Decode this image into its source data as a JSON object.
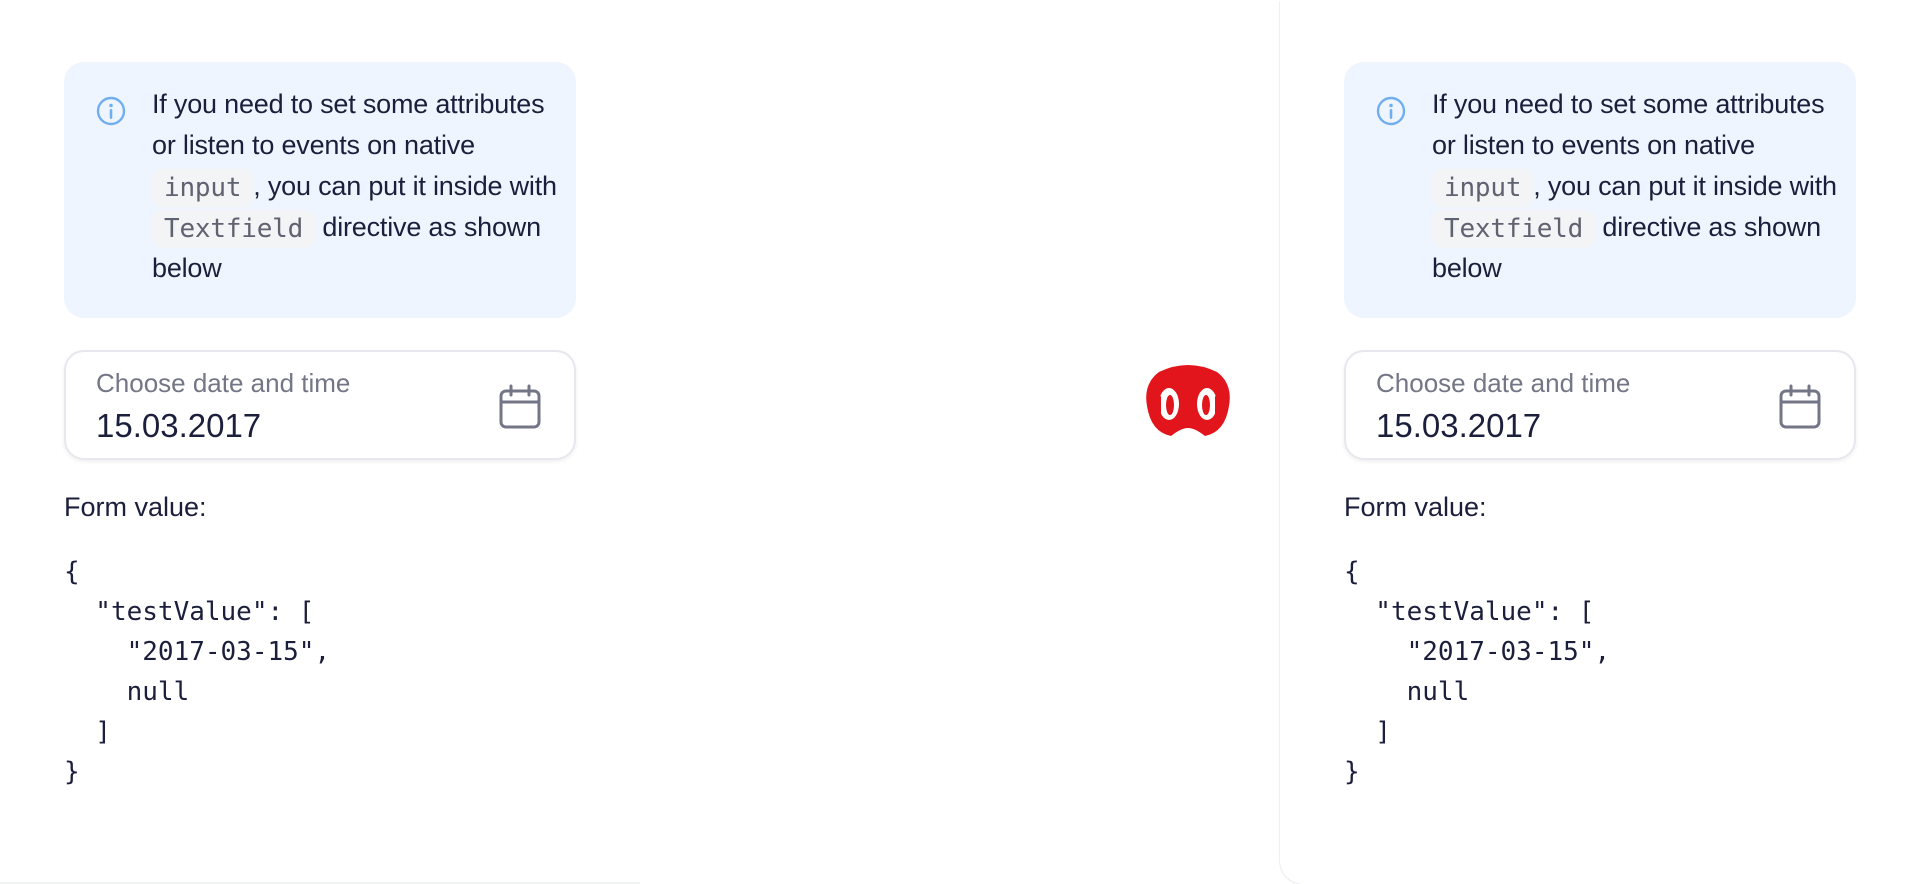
{
  "panels": [
    {
      "notice": {
        "line1": "If you need to set some attributes or listen to events on native ",
        "chip1": "input",
        "line2": ", you can put it inside with ",
        "chip2": "Textfield",
        "line3": " directive as shown below",
        "icon": "info-icon"
      },
      "datefield": {
        "label": "Choose date and time",
        "value": "15.03.2017",
        "icon": "calendar-icon"
      },
      "form_label": "Form value:",
      "form_json": "{\n  \"testValue\": [\n    \"2017-03-15\",\n    null\n  ]\n}"
    },
    {
      "notice": {
        "line1": "If you need to set some attributes or listen to events on native ",
        "chip1": "input",
        "line2": ", you can put it inside with ",
        "chip2": "Textfield",
        "line3": " directive as shown below",
        "icon": "info-icon"
      },
      "datefield": {
        "label": "Choose date and time",
        "value": "15.03.2017",
        "icon": "calendar-icon"
      },
      "form_label": "Form value:",
      "form_json": "{\n  \"testValue\": [\n    \"2017-03-15\",\n    null\n  ]\n}"
    }
  ],
  "logo": {
    "icon": "red-mascot-logo",
    "color": "#e2141c"
  },
  "colors": {
    "notice_bg": "#eef5fe",
    "info_icon": "#70aef0",
    "text": "#1b1f3b",
    "muted": "#737686"
  }
}
